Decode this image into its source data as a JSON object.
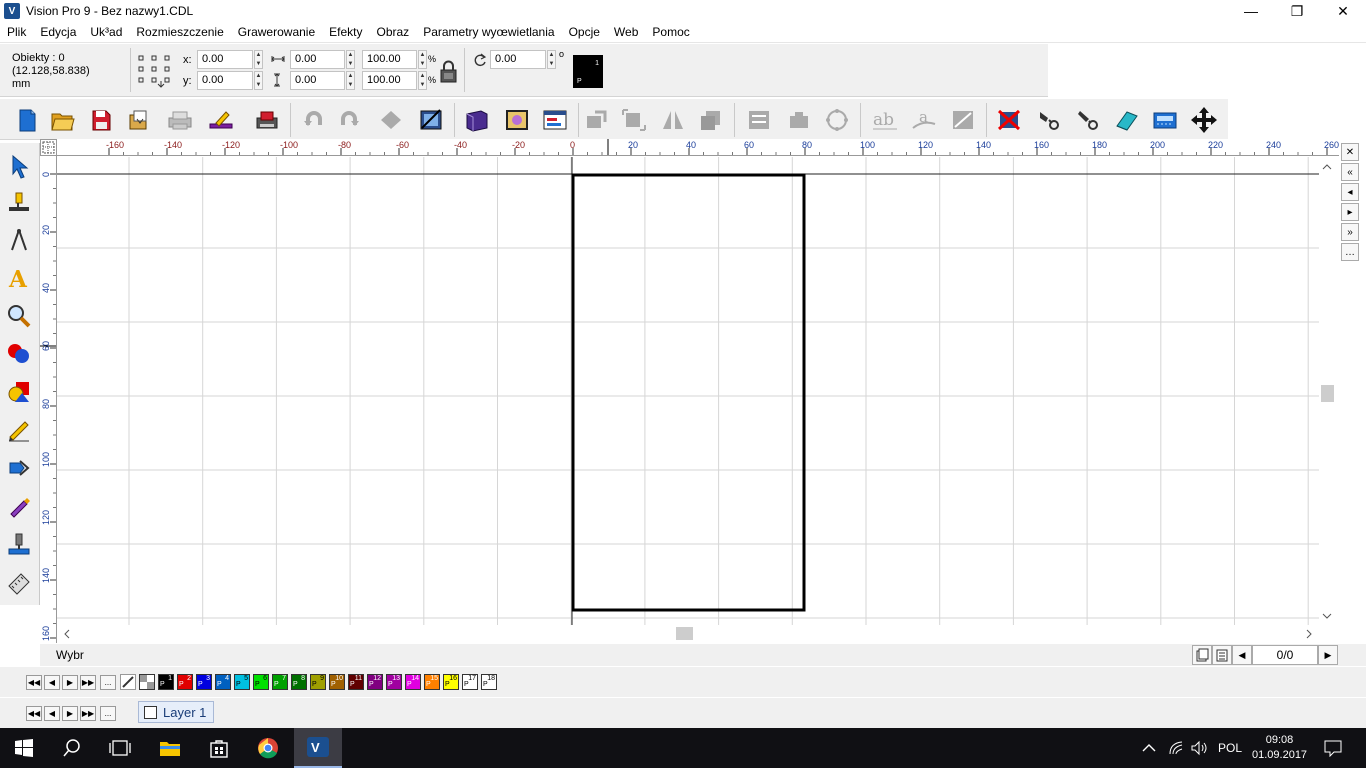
{
  "window": {
    "title": "Vision Pro 9  - Bez nazwy1.CDL",
    "app_icon": "V",
    "minimize_icon": "—",
    "maximize_icon": "❐",
    "close_icon": "✕"
  },
  "menu": [
    "Plik",
    "Edycja",
    "Uk³ad",
    "Rozmieszczenie",
    "Grawerowanie",
    "Efekty",
    "Obraz",
    "Parametry wyœwietlania",
    "Opcje",
    "Web",
    "Pomoc"
  ],
  "propbar": {
    "objects_label": "Obiekty : 0",
    "coords": "(12.128,58.838)",
    "unit": "mm",
    "x_label": "x:",
    "y_label": "y:",
    "x_value": "0.00",
    "y_value": "0.00",
    "width_value": "0.00",
    "height_value": "0.00",
    "scale_w": "100.00",
    "scale_h": "100.00",
    "percent_sign": "%",
    "rotation_value": "0.00",
    "degree_sign": "o",
    "pen_label": "P",
    "pen_number": "1"
  },
  "rulers": {
    "h_ticks": [
      "-160",
      "-140",
      "-120",
      "-100",
      "-80",
      "-60",
      "-40",
      "-20",
      "0",
      "20",
      "40",
      "60",
      "80",
      "100",
      "120",
      "140",
      "160",
      "180",
      "200",
      "220",
      "240",
      "260"
    ],
    "v_ticks": [
      "0",
      "20",
      "40",
      "60",
      "80",
      "100",
      "120",
      "140",
      "160"
    ]
  },
  "status": {
    "mode_text": "Wybr",
    "page_count": "0/0"
  },
  "palette": {
    "colors": [
      "#000000",
      "#e00000",
      "#0000e0",
      "#0060c0",
      "#00c0e0",
      "#00e000",
      "#00a000",
      "#007000",
      "#a0a000",
      "#a06000",
      "#600000",
      "#800080",
      "#a000a0",
      "#e000e0",
      "#ff8000",
      "#ffff00",
      "#ffffff",
      "#ffffff"
    ],
    "pen_numbers": [
      "1",
      "2",
      "3",
      "4",
      "5",
      "6",
      "7",
      "8",
      "9",
      "10",
      "11",
      "12",
      "13",
      "14",
      "15",
      "16",
      "17",
      "18"
    ],
    "pen_letter": "P",
    "more_label": "..."
  },
  "layers": {
    "layer_name": "Layer 1",
    "more_label": "..."
  },
  "taskbar": {
    "language": "POL",
    "time": "09:08",
    "date": "01.09.2017"
  }
}
